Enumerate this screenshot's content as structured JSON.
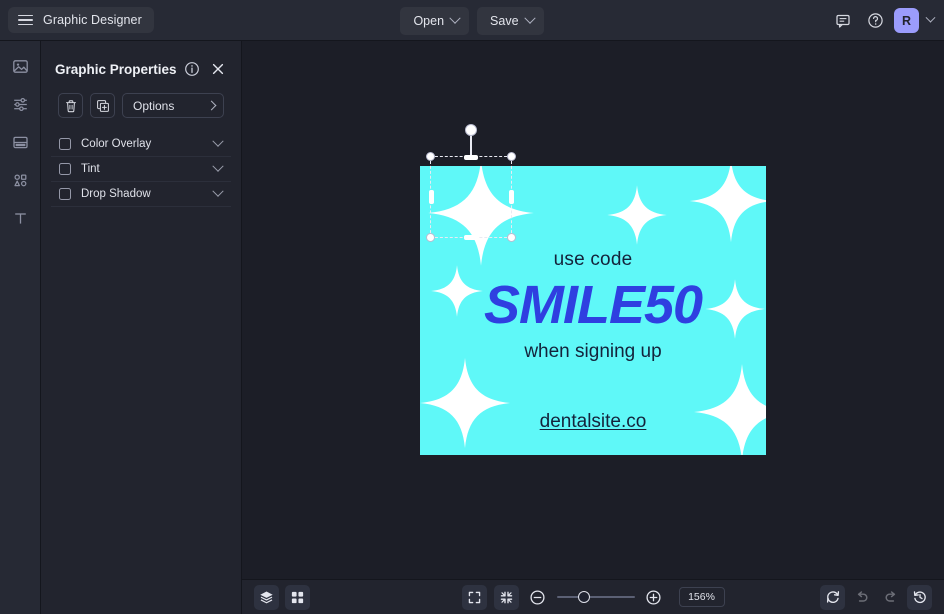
{
  "header": {
    "menu_icon": "hamburger-icon",
    "brand": "Graphic Designer",
    "open_label": "Open",
    "save_label": "Save",
    "comment_icon": "comment-icon",
    "help_icon": "help-circle-icon",
    "avatar_initial": "R",
    "avatar_color": "#9b9cfc"
  },
  "rail": {
    "items": [
      {
        "name": "image-icon",
        "label": "Image"
      },
      {
        "name": "adjustments-icon",
        "label": "Adjust"
      },
      {
        "name": "layout-icon",
        "label": "Layout"
      },
      {
        "name": "shapes-icon",
        "label": "Shapes"
      },
      {
        "name": "text-icon",
        "label": "Text"
      }
    ]
  },
  "panel": {
    "title": "Graphic Properties",
    "info_icon": "info-circle-icon",
    "close_icon": "close-icon",
    "delete_icon": "trash-icon",
    "duplicate_icon": "duplicate-icon",
    "options_label": "Options",
    "properties": [
      {
        "label": "Color Overlay",
        "checked": false
      },
      {
        "label": "Tint",
        "checked": false
      },
      {
        "label": "Drop Shadow",
        "checked": false
      }
    ]
  },
  "canvas": {
    "graphic": {
      "background": "#5ff8f8",
      "line1": "use code",
      "promo_code": "SMILE50",
      "promo_color": "#2f3fe0",
      "line2": "when signing up",
      "website": "dentalsite.co",
      "text_color": "#14233b"
    },
    "selection": {
      "label": "selected-sparkle-graphic",
      "rotate_handle": "rotate-handle"
    }
  },
  "bottom_bar": {
    "layers_icon": "layers-icon",
    "grid_icon": "grid-icon",
    "fit_screen_icon": "fit-to-screen-icon",
    "fit_selection_icon": "fit-selection-icon",
    "zoom_out_icon": "zoom-out-icon",
    "zoom_in_icon": "zoom-in-icon",
    "zoom_level": "156%",
    "slider_position_pct": 35,
    "reset_icon": "refresh-icon",
    "undo_icon": "undo-icon",
    "redo_icon": "redo-icon",
    "history_icon": "history-icon"
  }
}
